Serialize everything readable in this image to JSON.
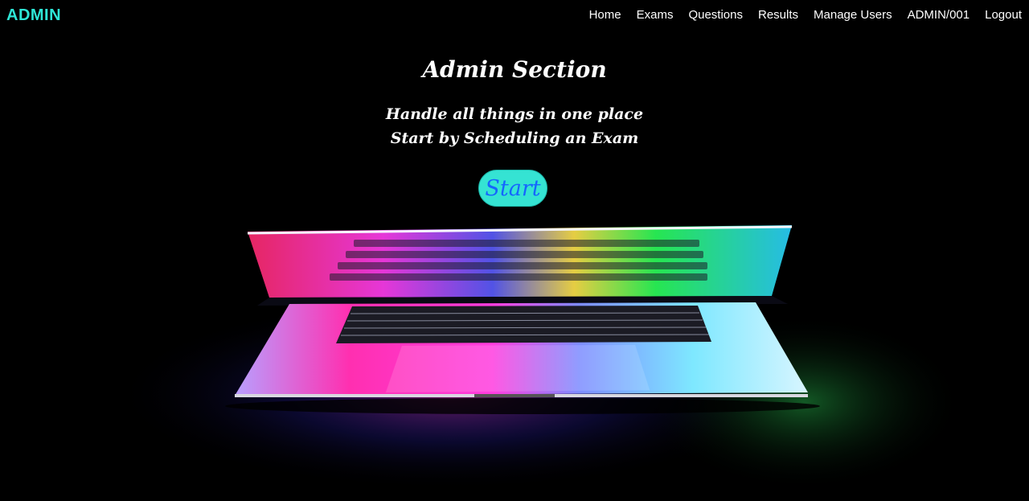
{
  "navbar": {
    "brand": "ADMIN",
    "links": [
      "Home",
      "Exams",
      "Questions",
      "Results",
      "Manage Users",
      "ADMIN/001",
      "Logout"
    ]
  },
  "hero": {
    "title": "Admin Section",
    "line1": "Handle all things in one place",
    "line2": "Start by Scheduling an Exam",
    "start_label": "Start"
  },
  "colors": {
    "accent": "#2ee6d6",
    "button_bg": "#35e3d3",
    "button_text": "#1565ff",
    "background": "#000000"
  }
}
